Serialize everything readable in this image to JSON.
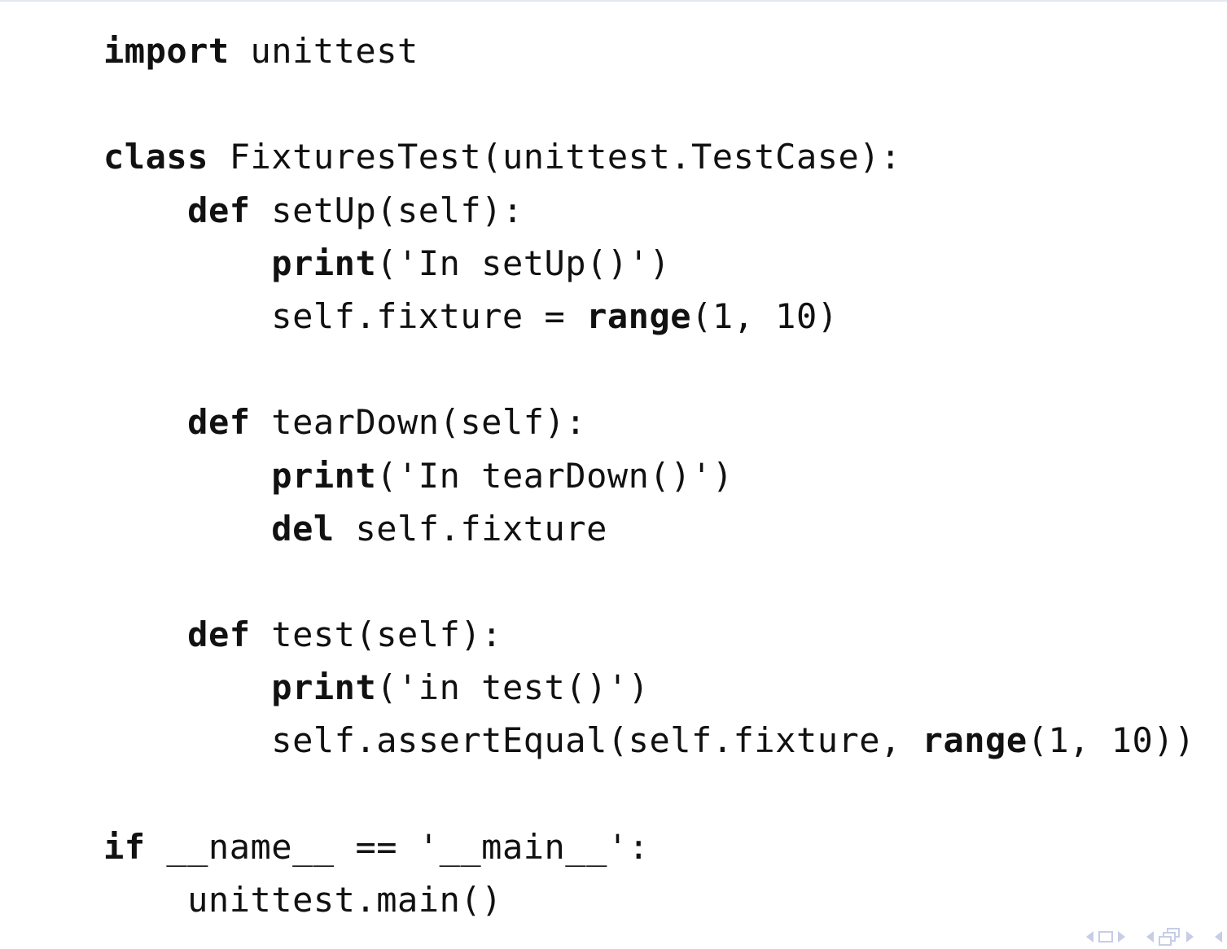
{
  "code": {
    "lines": [
      {
        "tokens": [
          {
            "t": "import",
            "kw": true
          },
          {
            "t": " unittest",
            "kw": false
          }
        ]
      },
      {
        "tokens": []
      },
      {
        "tokens": [
          {
            "t": "class",
            "kw": true
          },
          {
            "t": " FixturesTest(unittest.TestCase):",
            "kw": false
          }
        ]
      },
      {
        "tokens": [
          {
            "t": "    ",
            "kw": false
          },
          {
            "t": "def",
            "kw": true
          },
          {
            "t": " setUp(self):",
            "kw": false
          }
        ]
      },
      {
        "tokens": [
          {
            "t": "        ",
            "kw": false
          },
          {
            "t": "print",
            "kw": true
          },
          {
            "t": "('In setUp()')",
            "kw": false
          }
        ]
      },
      {
        "tokens": [
          {
            "t": "        self.fixture = ",
            "kw": false
          },
          {
            "t": "range",
            "kw": true
          },
          {
            "t": "(1, 10)",
            "kw": false
          }
        ]
      },
      {
        "tokens": []
      },
      {
        "tokens": [
          {
            "t": "    ",
            "kw": false
          },
          {
            "t": "def",
            "kw": true
          },
          {
            "t": " tearDown(self):",
            "kw": false
          }
        ]
      },
      {
        "tokens": [
          {
            "t": "        ",
            "kw": false
          },
          {
            "t": "print",
            "kw": true
          },
          {
            "t": "('In tearDown()')",
            "kw": false
          }
        ]
      },
      {
        "tokens": [
          {
            "t": "        ",
            "kw": false
          },
          {
            "t": "del",
            "kw": true
          },
          {
            "t": " self.fixture",
            "kw": false
          }
        ]
      },
      {
        "tokens": []
      },
      {
        "tokens": [
          {
            "t": "    ",
            "kw": false
          },
          {
            "t": "def",
            "kw": true
          },
          {
            "t": " test(self):",
            "kw": false
          }
        ]
      },
      {
        "tokens": [
          {
            "t": "        ",
            "kw": false
          },
          {
            "t": "print",
            "kw": true
          },
          {
            "t": "('in test()')",
            "kw": false
          }
        ]
      },
      {
        "tokens": [
          {
            "t": "        self.assertEqual(self.fixture, ",
            "kw": false
          },
          {
            "t": "range",
            "kw": true
          },
          {
            "t": "(1, 10))",
            "kw": false
          }
        ]
      },
      {
        "tokens": []
      },
      {
        "tokens": [
          {
            "t": "if",
            "kw": true
          },
          {
            "t": " __name__ == '__main__':",
            "kw": false
          }
        ]
      },
      {
        "tokens": [
          {
            "t": "    unittest.main()",
            "kw": false
          }
        ]
      }
    ]
  },
  "nav": {
    "color": "#c7cde6",
    "icons": [
      "prev-frame-icon",
      "frame-icon",
      "next-frame-icon",
      "prev-section-icon",
      "section-icon",
      "next-section-icon",
      "prev-icon"
    ]
  }
}
